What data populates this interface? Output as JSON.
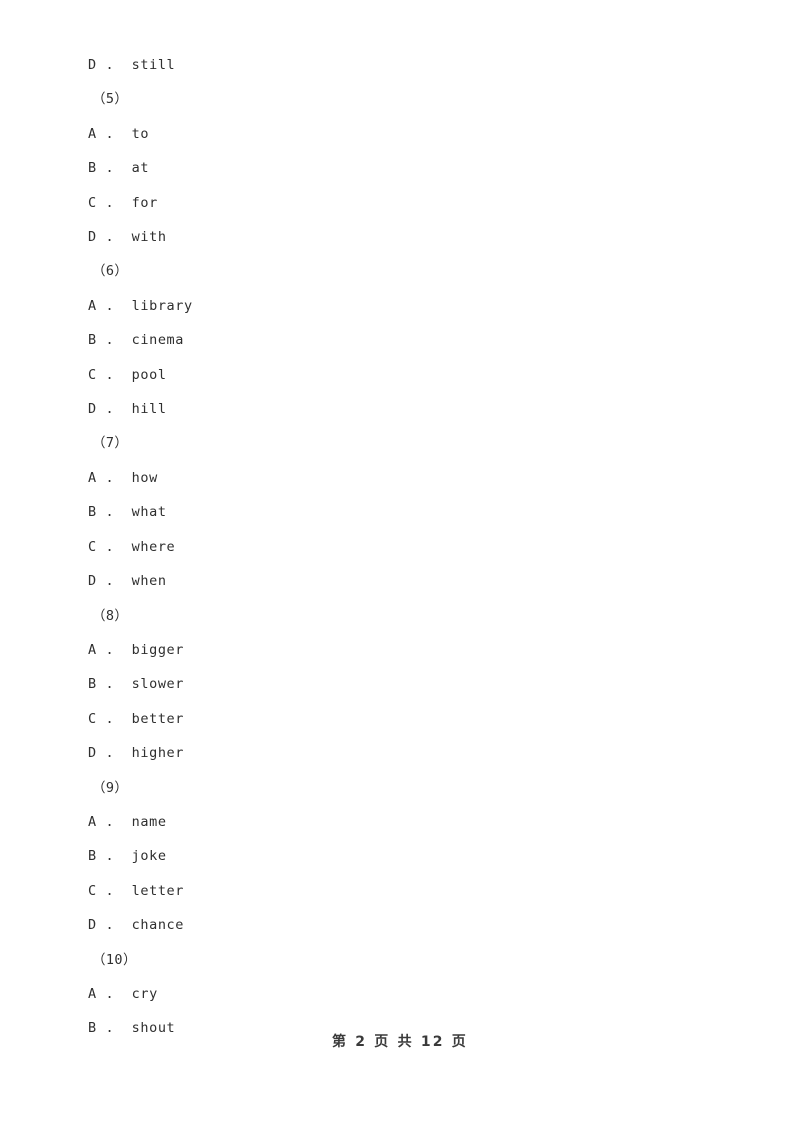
{
  "document": {
    "body_lines": [
      {
        "kind": "option",
        "letter": "D",
        "sep": " .  ",
        "text": "still",
        "full": "D .  still"
      },
      {
        "kind": "group",
        "full": "（5）"
      },
      {
        "kind": "option",
        "letter": "A",
        "sep": " .  ",
        "text": "to",
        "full": "A .  to"
      },
      {
        "kind": "option",
        "letter": "B",
        "sep": " .  ",
        "text": "at",
        "full": "B .  at"
      },
      {
        "kind": "option",
        "letter": "C",
        "sep": " .  ",
        "text": "for",
        "full": "C .  for"
      },
      {
        "kind": "option",
        "letter": "D",
        "sep": " .  ",
        "text": "with",
        "full": "D .  with"
      },
      {
        "kind": "group",
        "full": "（6）"
      },
      {
        "kind": "option",
        "letter": "A",
        "sep": " .  ",
        "text": "library",
        "full": "A .  library"
      },
      {
        "kind": "option",
        "letter": "B",
        "sep": " .  ",
        "text": "cinema",
        "full": "B .  cinema"
      },
      {
        "kind": "option",
        "letter": "C",
        "sep": " .  ",
        "text": "pool",
        "full": "C .  pool"
      },
      {
        "kind": "option",
        "letter": "D",
        "sep": " .  ",
        "text": "hill",
        "full": "D .  hill"
      },
      {
        "kind": "group",
        "full": "（7）"
      },
      {
        "kind": "option",
        "letter": "A",
        "sep": " .  ",
        "text": "how",
        "full": "A .  how"
      },
      {
        "kind": "option",
        "letter": "B",
        "sep": " .  ",
        "text": "what",
        "full": "B .  what"
      },
      {
        "kind": "option",
        "letter": "C",
        "sep": " .  ",
        "text": "where",
        "full": "C .  where"
      },
      {
        "kind": "option",
        "letter": "D",
        "sep": " .  ",
        "text": "when",
        "full": "D .  when"
      },
      {
        "kind": "group",
        "full": "（8）"
      },
      {
        "kind": "option",
        "letter": "A",
        "sep": " .  ",
        "text": "bigger",
        "full": "A .  bigger"
      },
      {
        "kind": "option",
        "letter": "B",
        "sep": " .  ",
        "text": "slower",
        "full": "B .  slower"
      },
      {
        "kind": "option",
        "letter": "C",
        "sep": " .  ",
        "text": "better",
        "full": "C .  better"
      },
      {
        "kind": "option",
        "letter": "D",
        "sep": " .  ",
        "text": "higher",
        "full": "D .  higher"
      },
      {
        "kind": "group",
        "full": "（9）"
      },
      {
        "kind": "option",
        "letter": "A",
        "sep": " .  ",
        "text": "name",
        "full": "A .  name"
      },
      {
        "kind": "option",
        "letter": "B",
        "sep": " .  ",
        "text": "joke",
        "full": "B .  joke"
      },
      {
        "kind": "option",
        "letter": "C",
        "sep": " .  ",
        "text": "letter",
        "full": "C .  letter"
      },
      {
        "kind": "option",
        "letter": "D",
        "sep": " .  ",
        "text": "chance",
        "full": "D .  chance"
      },
      {
        "kind": "group",
        "full": "（10）"
      },
      {
        "kind": "option",
        "letter": "A",
        "sep": " .  ",
        "text": "cry",
        "full": "A .  cry"
      },
      {
        "kind": "option",
        "letter": "B",
        "sep": " .  ",
        "text": "shout",
        "full": "B .  shout"
      }
    ]
  },
  "footer": {
    "page_label": "第 2 页 共 12 页",
    "current_page": "2",
    "total_pages": "12"
  },
  "colors": {
    "page_background": "#ffffff",
    "body_text": "#2f2f2f",
    "footer_text": "#3a3a3a"
  }
}
